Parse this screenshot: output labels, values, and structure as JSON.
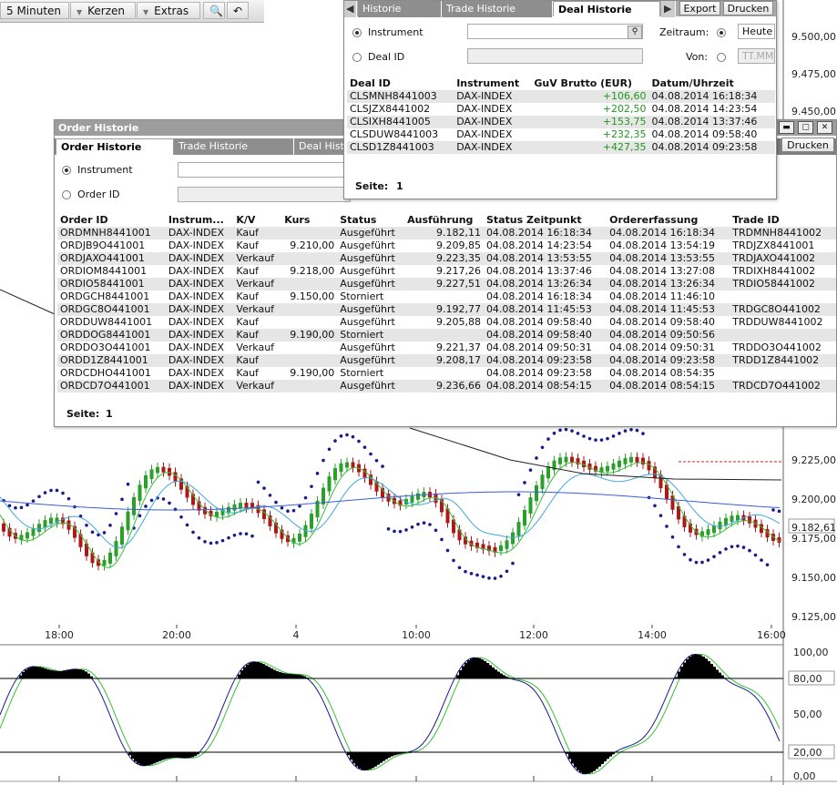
{
  "toolbar": {
    "interval": "5 Minuten",
    "candles": "Kerzen",
    "extras": "Extras"
  },
  "price_axis": [
    "9.500,00",
    "9.475,00",
    "9.450,00",
    "9.225,00",
    "9.200,00",
    "9.182,61",
    "9.175,00",
    "9.150,00",
    "9.125,00"
  ],
  "time_axis": [
    "18:00",
    "20:00",
    "4",
    "10:00",
    "12:00",
    "14:00",
    "16:00"
  ],
  "osc_axis": [
    "100,00",
    "80,00",
    "50,00",
    "20,00",
    "0,00"
  ],
  "order_window": {
    "title": "Order Historie",
    "tabs": [
      "Order Historie",
      "Trade Historie",
      "Deal Hist"
    ],
    "radio_instrument": "Instrument",
    "radio_order": "Order ID",
    "headers": [
      "Order ID",
      "Instrum...",
      "K/V",
      "Kurs",
      "Status",
      "Ausführung",
      "Status Zeitpunkt",
      "Ordererfassung",
      "Trade ID"
    ],
    "rows": [
      [
        "ORDMNH8441001",
        "DAX-INDEX",
        "Kauf",
        "",
        "Ausgeführt",
        "9.182,11",
        "04.08.2014 16:18:34",
        "04.08.2014 16:18:34",
        "TRDMNH8441002"
      ],
      [
        "ORDJB9O441001",
        "DAX-INDEX",
        "Kauf",
        "9.210,00",
        "Ausgeführt",
        "9.209,85",
        "04.08.2014 14:23:54",
        "04.08.2014 13:54:19",
        "TRDJZX8441001"
      ],
      [
        "ORDJAXO441001",
        "DAX-INDEX",
        "Verkauf",
        "",
        "Ausgeführt",
        "9.223,35",
        "04.08.2014 13:53:55",
        "04.08.2014 13:53:55",
        "TRDJAXO441002"
      ],
      [
        "ORDIOM8441001",
        "DAX-INDEX",
        "Kauf",
        "9.218,00",
        "Ausgeführt",
        "9.217,26",
        "04.08.2014 13:37:46",
        "04.08.2014 13:27:08",
        "TRDIXH8441002"
      ],
      [
        "ORDIO58441001",
        "DAX-INDEX",
        "Verkauf",
        "",
        "Ausgeführt",
        "9.227,51",
        "04.08.2014 13:26:34",
        "04.08.2014 13:26:34",
        "TRDIO58441002"
      ],
      [
        "ORDGCH8441001",
        "DAX-INDEX",
        "Kauf",
        "9.150,00",
        "Storniert",
        "",
        "04.08.2014 16:18:34",
        "04.08.2014 11:46:10",
        ""
      ],
      [
        "ORDGC8O441001",
        "DAX-INDEX",
        "Verkauf",
        "",
        "Ausgeführt",
        "9.192,77",
        "04.08.2014 11:45:53",
        "04.08.2014 11:45:53",
        "TRDGC8O441002"
      ],
      [
        "ORDDUW8441001",
        "DAX-INDEX",
        "Kauf",
        "",
        "Ausgeführt",
        "9.205,88",
        "04.08.2014 09:58:40",
        "04.08.2014 09:58:40",
        "TRDDUW8441002"
      ],
      [
        "ORDDOG8441001",
        "DAX-INDEX",
        "Kauf",
        "9.190,00",
        "Storniert",
        "",
        "04.08.2014 09:58:40",
        "04.08.2014 09:50:56",
        ""
      ],
      [
        "ORDDO3O441001",
        "DAX-INDEX",
        "Verkauf",
        "",
        "Ausgeführt",
        "9.221,37",
        "04.08.2014 09:50:31",
        "04.08.2014 09:50:31",
        "TRDDO3O441002"
      ],
      [
        "ORDD1Z8441001",
        "DAX-INDEX",
        "Kauf",
        "",
        "Ausgeführt",
        "9.208,17",
        "04.08.2014 09:23:58",
        "04.08.2014 09:23:58",
        "TRDD1Z8441002"
      ],
      [
        "ORDCDHO441001",
        "DAX-INDEX",
        "Kauf",
        "9.190,00",
        "Storniert",
        "",
        "04.08.2014 09:23:58",
        "04.08.2014 08:54:35",
        ""
      ],
      [
        "ORDCD7O441001",
        "DAX-INDEX",
        "Verkauf",
        "",
        "Ausgeführt",
        "9.236,66",
        "04.08.2014 08:54:15",
        "04.08.2014 08:54:15",
        "TRDCD7O441002"
      ]
    ],
    "page_label": "Seite:",
    "page": "1",
    "print_label": "Drucken"
  },
  "deal_window": {
    "tabs": [
      "Historie",
      "Trade Historie",
      "Deal Historie"
    ],
    "export_label": "Export",
    "print_label": "Drucken",
    "radio_instrument": "Instrument",
    "radio_deal": "Deal ID",
    "zeitraum_label": "Zeitraum:",
    "heute": "Heute",
    "von_label": "Von:",
    "von_placeholder": "TT.MM",
    "headers": [
      "Deal ID",
      "Instrument",
      "GuV Brutto (EUR)",
      "Datum/Uhrzeit"
    ],
    "rows": [
      [
        "CLSMNH8441003",
        "DAX-INDEX",
        "+106,60",
        "04.08.2014 16:18:34"
      ],
      [
        "CLSJZX8441002",
        "DAX-INDEX",
        "+202,50",
        "04.08.2014 14:23:54"
      ],
      [
        "CLSIXH8441005",
        "DAX-INDEX",
        "+153,75",
        "04.08.2014 13:37:46"
      ],
      [
        "CLSDUW8441003",
        "DAX-INDEX",
        "+232,35",
        "04.08.2014 09:58:40"
      ],
      [
        "CLSD1Z8441003",
        "DAX-INDEX",
        "+427,35",
        "04.08.2014 09:23:58"
      ]
    ],
    "page_label": "Seite:",
    "page": "1"
  },
  "colors": {
    "bull": "#2aa02a",
    "bear": "#b01818",
    "psar": "#1a1a8c",
    "ma_blue": "#3b5bdc",
    "ma_light": "#40a8e0",
    "ma_green": "#35c035",
    "ma_black": "#222",
    "gain": "#1c9a1c"
  }
}
